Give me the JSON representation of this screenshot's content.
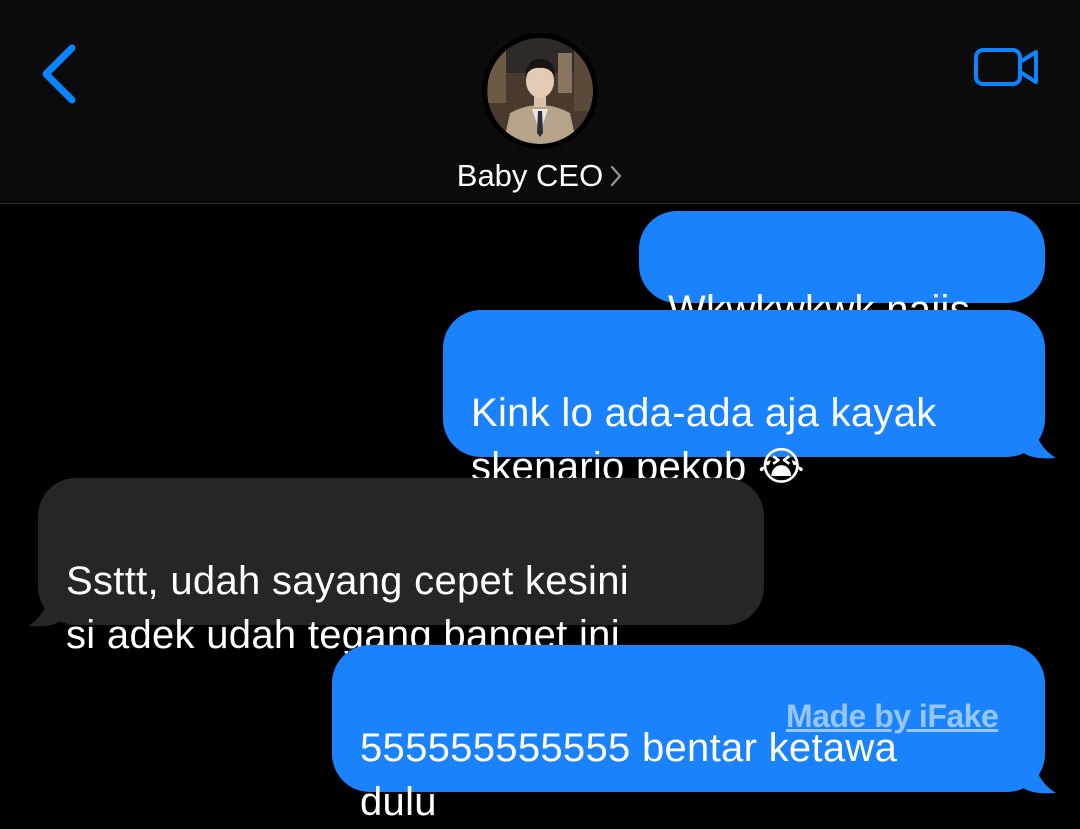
{
  "header": {
    "contact_name": "Baby CEO",
    "back_icon": "chevron-left-icon",
    "video_icon": "video-camera-icon",
    "accent_color": "#0a84ff"
  },
  "messages": [
    {
      "direction": "sent",
      "text": "Wkwkwkwk najis"
    },
    {
      "direction": "sent",
      "text": "Kink lo ada-ada aja kayak\nskenario pekob 😭"
    },
    {
      "direction": "received",
      "text": "Ssttt, udah sayang cepet kesini\nsi adek udah tegang banget ini"
    },
    {
      "direction": "sent",
      "text": "555555555555 bentar ketawa\ndulu"
    }
  ],
  "colors": {
    "sent_bubble": "#1982fc",
    "received_bubble": "#262629",
    "background": "#000000"
  },
  "watermark": "Made by iFake"
}
